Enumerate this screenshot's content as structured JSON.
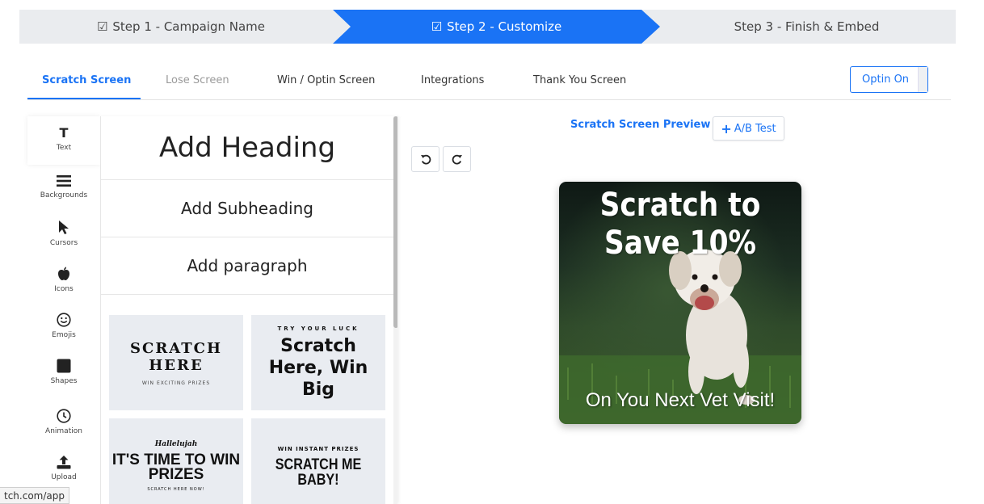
{
  "stepper": {
    "steps": [
      {
        "label": "Step 1 - Campaign Name",
        "checked": true
      },
      {
        "label": "Step 2 - Customize",
        "checked": true
      },
      {
        "label": "Step 3 - Finish & Embed",
        "checked": false
      }
    ],
    "active_color": "#1a73f5"
  },
  "tabs": {
    "items": [
      "Scratch Screen",
      "Lose Screen",
      "Win / Optin Screen",
      "Integrations",
      "Thank You Screen"
    ],
    "active": "Scratch Screen",
    "optin_label": "Optin On"
  },
  "rail": {
    "items": [
      {
        "label": "Text",
        "icon": "text-icon"
      },
      {
        "label": "Backgrounds",
        "icon": "bars-icon"
      },
      {
        "label": "Cursors",
        "icon": "cursor-icon"
      },
      {
        "label": "Icons",
        "icon": "apple-icon"
      },
      {
        "label": "Emojis",
        "icon": "smile-icon"
      },
      {
        "label": "Shapes",
        "icon": "square-icon"
      },
      {
        "label": "Animation",
        "icon": "clock-icon"
      },
      {
        "label": "Upload",
        "icon": "upload-icon"
      }
    ]
  },
  "panel": {
    "heading": "Add Heading",
    "subheading": "Add Subheading",
    "paragraph": "Add paragraph",
    "templates": [
      {
        "big": "SCRATCH HERE",
        "small": "WIN EXCITING PRIZES"
      },
      {
        "small": "TRY YOUR LUCK",
        "big": "Scratch Here, Win Big"
      },
      {
        "script": "Hallelujah",
        "big": "IT'S TIME TO WIN PRIZES",
        "small": "SCRATCH HERE NOW!"
      },
      {
        "small": "WIN INSTANT PRIZES",
        "big": "SCRATCH ME BABY!"
      }
    ]
  },
  "preview": {
    "title": "Scratch Screen Preview",
    "ab_test_label": "A/B Test",
    "card": {
      "heading": "Scratch to Save 10%",
      "footer": "On You Next Vet Visit!"
    }
  },
  "status": {
    "url": "tch.com/app"
  }
}
